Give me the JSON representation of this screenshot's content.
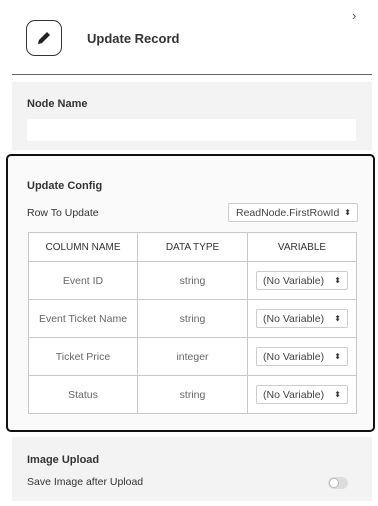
{
  "header": {
    "title": "Update Record",
    "edit_icon": "pencil-icon",
    "collapse_icon": "chevron-right-icon",
    "collapse_glyph": "›"
  },
  "node_section": {
    "title": "Node Name",
    "input_value": "",
    "input_placeholder": ""
  },
  "config_section": {
    "title": "Update Config",
    "row_label": "Row To Update",
    "row_value": "ReadNode.FirstRowId",
    "table": {
      "headers": [
        "COLUMN NAME",
        "DATA TYPE",
        "VARIABLE"
      ],
      "rows": [
        {
          "column": "Event ID",
          "type": "string",
          "variable": "(No Variable)"
        },
        {
          "column": "Event Ticket Name",
          "type": "string",
          "variable": "(No Variable)"
        },
        {
          "column": "Ticket Price",
          "type": "integer",
          "variable": "(No Variable)"
        },
        {
          "column": "Status",
          "type": "string",
          "variable": "(No Variable)"
        }
      ]
    }
  },
  "upload_section": {
    "title": "Image Upload",
    "toggle_label": "Save Image after Upload",
    "toggle_on": false
  },
  "colors": {
    "panel_bg": "#f3f3f3",
    "highlight_border": "#111111"
  },
  "updown_glyph": "⬍"
}
